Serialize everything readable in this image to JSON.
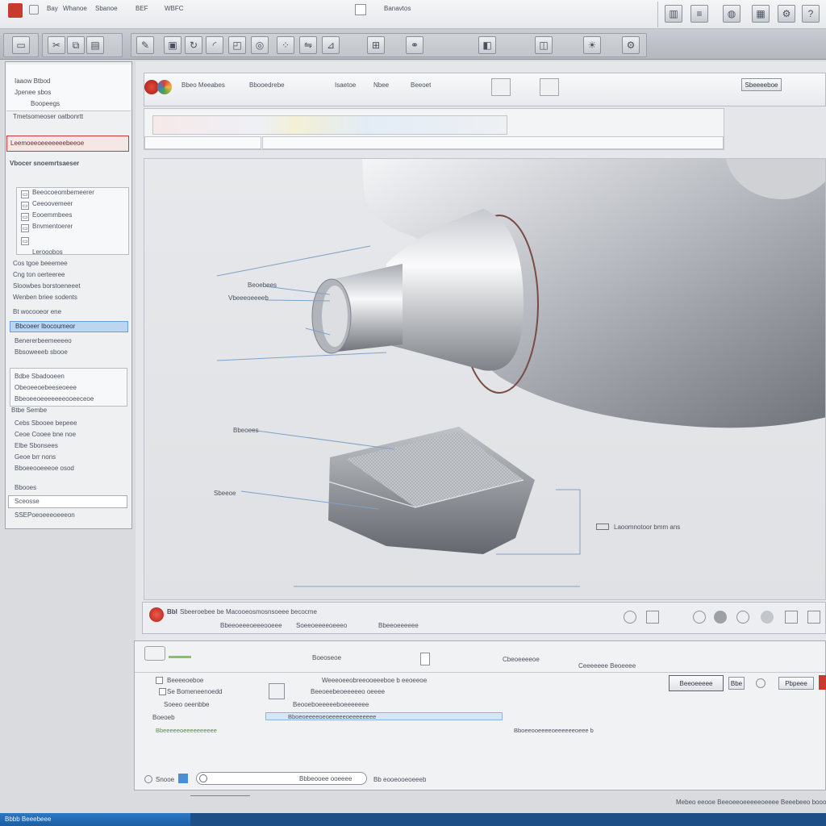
{
  "titlebar": {
    "menu": [
      "Bay",
      "Whanoe",
      "Sbanoe",
      "BEF",
      "WBFC"
    ],
    "center_tab": "Banavtos"
  },
  "left_panel": {
    "header_items": [
      "Iaaow Btbod",
      "Jpenee sbos",
      "Boopeegs"
    ],
    "breadcrumb": "Tmetsomeoser oatbonrtt",
    "selected_red": "Leemoeeoeeeeeeebeeoe",
    "section1_title": "Vbocer snoemrtsaeser",
    "tree1": [
      "Beeocoeombemeerer",
      "Ceeoovemeer",
      "Eooemmbees",
      "Bnvmentoerer",
      "Lerooobos"
    ],
    "tree2": [
      "Cos tgoe beeemee",
      "Cng ton oerteeree",
      "Sloowbes borstoeneeet",
      "Wenben briee sodents"
    ],
    "group_label": "Bt wocooeor ene",
    "highlighted_row": "Bbcoeer Ibocoumeor",
    "tree3": [
      "Benererbeemeeeeo",
      "Bbsoweeeb sbooe"
    ],
    "tree4": [
      "Bdbe Sbadooeen",
      "Obeoeeoebeeseoeee",
      "Bbeoeeoeeeeeeeooeeceoe"
    ],
    "section2_title": "Btbe Sembe",
    "tree5": [
      "Cebs Sbooee bepeee",
      "Ceoe Cooee bne noe",
      "Elbe Sbonsees",
      "Geoe brr nons",
      "Bboeeooeeeoe osod"
    ],
    "footer_items": [
      "Bbooes",
      "Sceosse",
      "SSEPoeoeeeoeeeon"
    ]
  },
  "doc_toolbar": {
    "items": [
      "Bbeo Meeabes",
      "Bbooedrebe",
      "Isaetoe",
      "Nbee",
      "Beeoet"
    ],
    "right_button": "Sbeeeeboe"
  },
  "viewport": {
    "callouts": [
      "Beoebees",
      "Vbeeeoeeeeb",
      "Bbeoees",
      "Sbeeoe",
      "Laoomnotoor bmm ans"
    ]
  },
  "status_row": {
    "label": "Bbl",
    "text1": "Sbeeroebee be Macooeosmosnsoeee becocme",
    "tab1": "Bbeeoeeeoeeeooeee",
    "tab2": "Soeeoeeeeoeeeo",
    "tab3": "Bbeeoeeeeee"
  },
  "bottom_panel": {
    "title": "Boeoseoe",
    "col1": [
      "Beeeeoeboe",
      "Se Bomeneenoedd",
      "Soeeo oeenbbe"
    ],
    "col2_title": "Weeeoeeobreeooeeeboe b eeoeeoe",
    "col2_rows": [
      "Beeoeebeoeeeeeo oeeee",
      "Beooeboeeeeeboeeeeeee",
      "Bboeoeeeeoeoeeeeeoeeeeeeee"
    ],
    "mid_label": "Boeoeb",
    "right_title": "Cbeoeeeeoe",
    "right_sub": "Ceeeeeee Beoeeee",
    "ok_button": "Beeoeeeee",
    "cancel_button": "Bbe",
    "apply_button": "Pbpeee",
    "footer_text": "Bboeeooeeeeoeeeeeeoeee b",
    "sel_text": "Beeoeebeeoeeee",
    "green_text": "Bbeeeeeoeeeeeeeeee",
    "bottom_search_value": "Bbbeooee ooeeee",
    "bottom_zoom": "Snooe",
    "bottom_right_text": "Bb eooeooeoeeeb"
  },
  "footer": {
    "right_text": "Mebeo eeooe Beeoeeoeeeeeoeeee Beeebeeo boooe",
    "task": "Bbbb Beeebeee"
  }
}
